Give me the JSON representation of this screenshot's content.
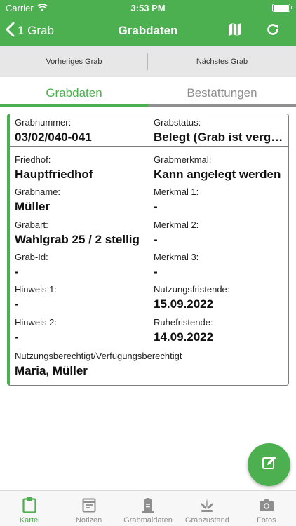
{
  "colors": {
    "accent": "#4caf50",
    "inactive": "#8f8f8f",
    "tabbar_inactive": "#8e8e8e"
  },
  "status_bar": {
    "carrier": "Carrier",
    "time": "3:53 PM"
  },
  "nav": {
    "back_label": "1 Grab",
    "title": "Grabdaten",
    "map_icon": "map-icon",
    "refresh_icon": "refresh-icon"
  },
  "grave_nav": {
    "previous": "Vorheriges Grab",
    "next": "Nächstes Grab"
  },
  "tabs": [
    {
      "label": "Grabdaten",
      "active": true
    },
    {
      "label": "Bestattungen",
      "active": false
    }
  ],
  "card": {
    "grabnummer": {
      "label": "Grabnummer:",
      "value": "03/02/040-041"
    },
    "grabstatus": {
      "label": "Grabstatus:",
      "value": "Belegt (Grab ist vergeben)"
    },
    "friedhof": {
      "label": "Friedhof:",
      "value": "Hauptfriedhof"
    },
    "grabmerkmal": {
      "label": "Grabmerkmal:",
      "value": "Kann angelegt werden"
    },
    "grabname": {
      "label": "Grabname:",
      "value": "Müller"
    },
    "merkmal1": {
      "label": "Merkmal 1:",
      "value": "-"
    },
    "grabart": {
      "label": "Grabart:",
      "value": "Wahlgrab 25 / 2 stellig"
    },
    "merkmal2": {
      "label": "Merkmal 2:",
      "value": "-"
    },
    "grab_id": {
      "label": "Grab-Id:",
      "value": "-"
    },
    "merkmal3": {
      "label": "Merkmal 3:",
      "value": "-"
    },
    "hinweis1": {
      "label": "Hinweis 1:",
      "value": "-"
    },
    "nutzungsfristende": {
      "label": "Nutzungsfristende:",
      "value": "15.09.2022"
    },
    "hinweis2": {
      "label": "Hinweis 2:",
      "value": "-"
    },
    "ruhefristende": {
      "label": "Ruhefristende:",
      "value": "14.09.2022"
    },
    "berechtigt": {
      "label": "Nutzungsberechtigt/Verfügungsberechtigt",
      "value": "Maria, Müller"
    }
  },
  "fab": {
    "icon": "edit-icon"
  },
  "tab_bar": [
    {
      "label": "Kartei",
      "icon": "clipboard-icon",
      "active": true
    },
    {
      "label": "Notizen",
      "icon": "notes-icon",
      "active": false
    },
    {
      "label": "Grabmaldaten",
      "icon": "gravestone-icon",
      "active": false
    },
    {
      "label": "Grabzustand",
      "icon": "plant-icon",
      "active": false
    },
    {
      "label": "Fotos",
      "icon": "camera-icon",
      "active": false
    }
  ]
}
